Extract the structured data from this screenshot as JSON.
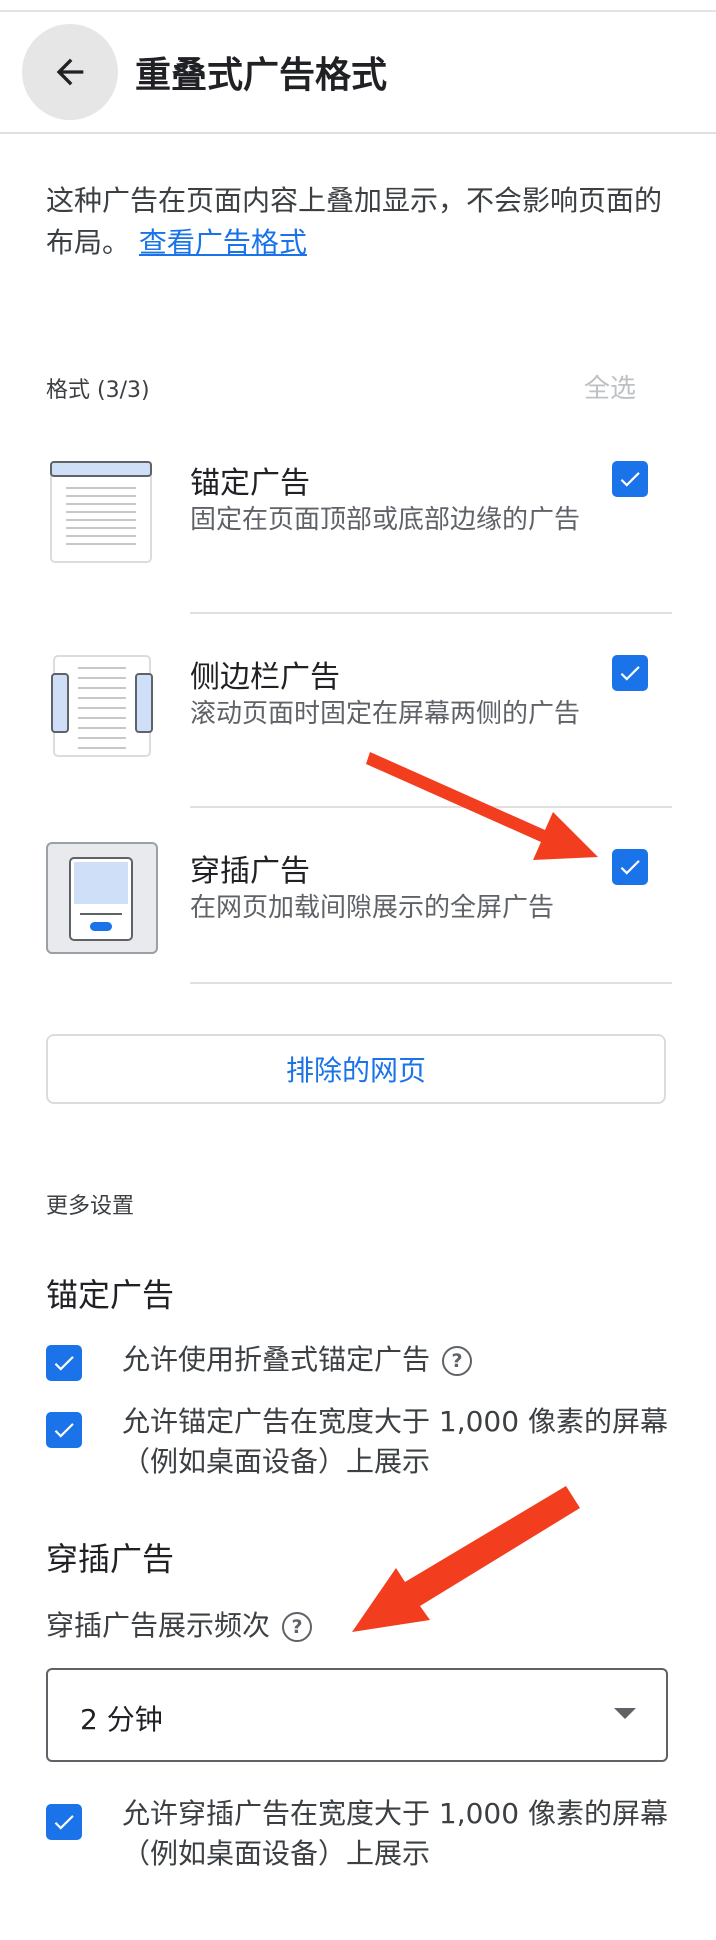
{
  "header": {
    "title": "重叠式广告格式",
    "back_icon": "arrow-left-icon"
  },
  "intro": {
    "text": "这种广告在页面内容上叠加显示，不会影响页面的布局。",
    "link": "查看广告格式"
  },
  "formats": {
    "label": "格式 (3/3)",
    "select_all": "全选",
    "items": [
      {
        "title": "锚定广告",
        "description": "固定在页面顶部或底部边缘的广告",
        "checked": true
      },
      {
        "title": "侧边栏广告",
        "description": "滚动页面时固定在屏幕两侧的广告",
        "checked": true
      },
      {
        "title": "穿插广告",
        "description": "在网页加载间隙展示的全屏广告",
        "checked": true
      }
    ]
  },
  "excluded_pages_button": "排除的网页",
  "more_settings": {
    "label": "更多设置",
    "anchor": {
      "title": "锚定广告",
      "options": [
        {
          "text": "允许使用折叠式锚定广告",
          "checked": true,
          "has_help": true
        },
        {
          "text": "允许锚定广告在宽度大于 1,000 像素的屏幕（例如桌面设备）上展示",
          "checked": true
        }
      ]
    },
    "vignette": {
      "title": "穿插广告",
      "frequency_label": "穿插广告展示频次",
      "frequency_value": "2 分钟",
      "options": [
        {
          "text": "允许穿插广告在宽度大于 1,000 像素的屏幕（例如桌面设备）上展示",
          "checked": true
        }
      ]
    }
  },
  "colors": {
    "accent": "#1a73e8",
    "annotation_arrow": "#f23d1f"
  }
}
